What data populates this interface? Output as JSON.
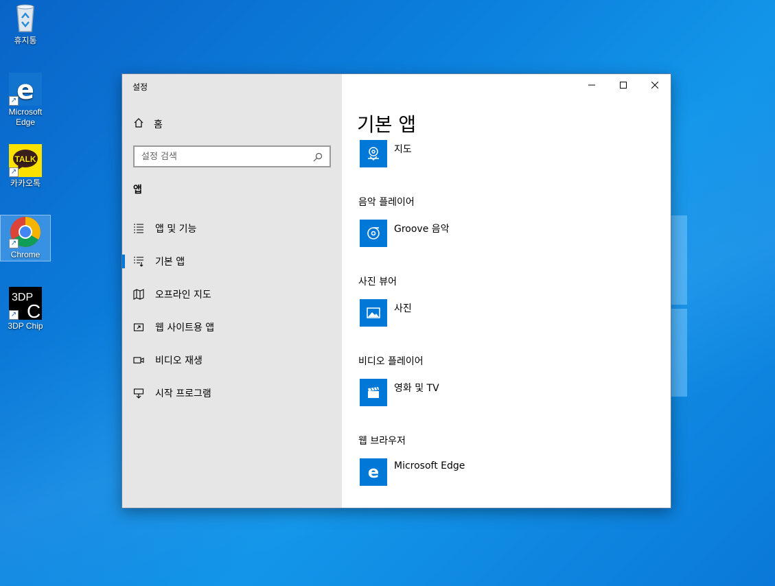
{
  "desktop": {
    "icons": [
      {
        "label": "휴지통"
      },
      {
        "label": "Microsoft Edge"
      },
      {
        "label": "카카오톡"
      },
      {
        "label": "Chrome"
      },
      {
        "label": "3DP Chip"
      }
    ],
    "kakao_badge": "TALK",
    "threedp_text": "3DP",
    "threedp_letter": "C"
  },
  "window": {
    "title": "설정",
    "sidebar": {
      "home_label": "홈",
      "search_placeholder": "설정 검색",
      "section": "앱",
      "items": [
        {
          "label": "앱 및 기능",
          "icon": "list-icon"
        },
        {
          "label": "기본 앱",
          "icon": "default-apps-icon",
          "active": true
        },
        {
          "label": "오프라인 지도",
          "icon": "map-icon"
        },
        {
          "label": "웹 사이트용 앱",
          "icon": "web-app-icon"
        },
        {
          "label": "비디오 재생",
          "icon": "video-icon"
        },
        {
          "label": "시작 프로그램",
          "icon": "startup-icon"
        }
      ]
    },
    "content": {
      "title": "기본 앱",
      "maps_app": "지도",
      "categories": [
        {
          "label": "음악 플레이어",
          "app": "Groove 음악"
        },
        {
          "label": "사진 뷰어",
          "app": "사진"
        },
        {
          "label": "비디오 플레이어",
          "app": "영화 및 TV"
        },
        {
          "label": "웹 브라우저",
          "app": "Microsoft Edge"
        }
      ]
    }
  },
  "colors": {
    "accent": "#0078d7",
    "sidebar_bg": "#e6e6e6"
  }
}
